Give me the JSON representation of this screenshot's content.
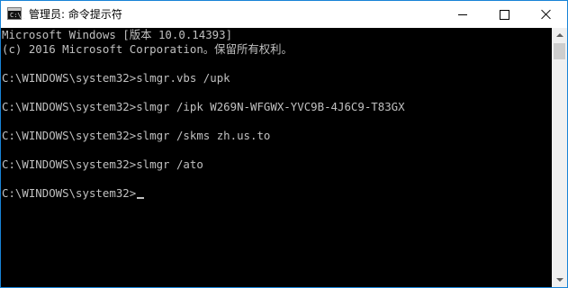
{
  "window": {
    "title": "管理员: 命令提示符",
    "app_icon_text": "C:\\_"
  },
  "titlebar_buttons": {
    "minimize_icon": "minimize-icon",
    "maximize_icon": "maximize-icon",
    "close_icon": "close-icon"
  },
  "console": {
    "lines": [
      "Microsoft Windows [版本 10.0.14393]",
      "(c) 2016 Microsoft Corporation。保留所有权利。",
      "",
      "C:\\WINDOWS\\system32>slmgr.vbs /upk",
      "",
      "C:\\WINDOWS\\system32>slmgr /ipk W269N-WFGWX-YVC9B-4J6C9-T83GX",
      "",
      "C:\\WINDOWS\\system32>slmgr /skms zh.us.to",
      "",
      "C:\\WINDOWS\\system32>slmgr /ato",
      "",
      "C:\\WINDOWS\\system32>"
    ]
  },
  "colors": {
    "console_background": "#000000",
    "console_text": "#c0c0c0",
    "window_border": "#1883d7",
    "titlebar_background": "#ffffff"
  }
}
